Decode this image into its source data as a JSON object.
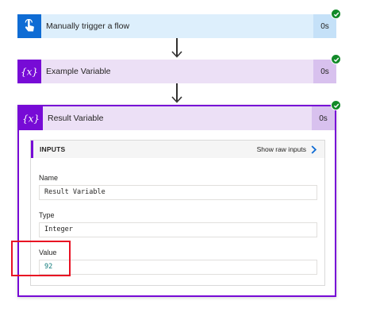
{
  "steps": [
    {
      "title": "Manually trigger a flow",
      "duration": "0s",
      "icon": "touch-hand-icon"
    },
    {
      "title": "Example Variable",
      "duration": "0s",
      "icon": "variable-icon"
    },
    {
      "title": "Result Variable",
      "duration": "0s",
      "icon": "variable-icon"
    }
  ],
  "status_icon": "success-check-icon",
  "inputs": {
    "header": "INPUTS",
    "show_raw": "Show raw inputs",
    "fields": [
      {
        "label": "Name",
        "value": "Result Variable"
      },
      {
        "label": "Type",
        "value": "Integer"
      },
      {
        "label": "Value",
        "value": "92"
      }
    ]
  },
  "colors": {
    "trigger_blue": "#0f6cd4",
    "variable_purple": "#770bd6",
    "success_green": "#128a29",
    "highlight_red": "#e81123"
  }
}
